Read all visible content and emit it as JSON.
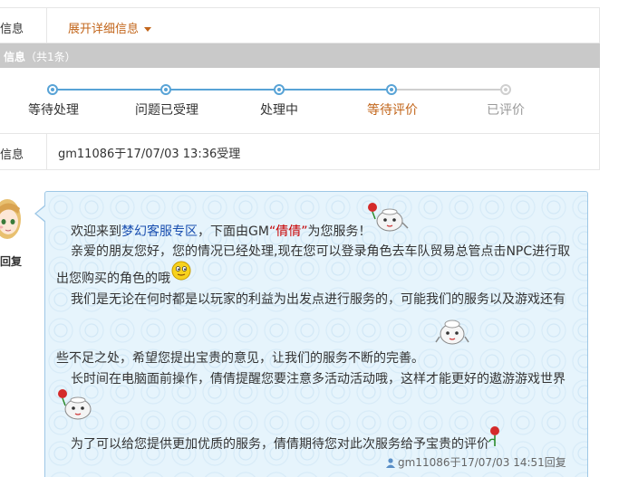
{
  "detail_row": {
    "label": "信息",
    "expand_label": "展开详细信息"
  },
  "progress_bar": {
    "title": "信息",
    "count": "（共1条）"
  },
  "steps": [
    {
      "label": "等待处理",
      "state": "done"
    },
    {
      "label": "问题已受理",
      "state": "done"
    },
    {
      "label": "处理中",
      "state": "done"
    },
    {
      "label": "等待评价",
      "state": "current"
    },
    {
      "label": "已评价",
      "state": "todo"
    }
  ],
  "accept_row": {
    "label": "信息",
    "value": "gm11086于17/07/03 13:36受理"
  },
  "reply_label": "回复",
  "message": {
    "l1_a": "欢迎来到",
    "l1_b": "梦幻客服专区",
    "l1_c": "，下面由GM",
    "l1_d": "“倩倩”",
    "l1_e": "为您服务！",
    "l2": "亲爱的朋友您好，您的情况已经处理,现在您可以登录角色去车队贸易总管点击NPC进行取",
    "l3": "出您购买的角色的哦",
    "l4": "我们是无论在何时都是以玩家的利益为出发点进行服务的，可能我们的服务以及游戏还有",
    "l5": "些不足之处，希望您提出宝贵的意见，让我们的服务不断的完善。",
    "l6": "长时间在电脑面前操作，倩倩提醒您要注意多活动活动哦，这样才能更好的遨游游戏世界",
    "l7": "为了可以给您提供更加优质的服务，倩倩期待您对此次服务给予宝贵的评价",
    "footer": "gm11086于17/07/03 14:51回复"
  },
  "colors": {
    "accent": "#c2651a",
    "progress": "#58a3d6",
    "bubble_bg": "#e6f4fc",
    "bubble_border": "#9ec7e6",
    "link_blue": "#1a4fb0",
    "name_red": "#c80000"
  }
}
